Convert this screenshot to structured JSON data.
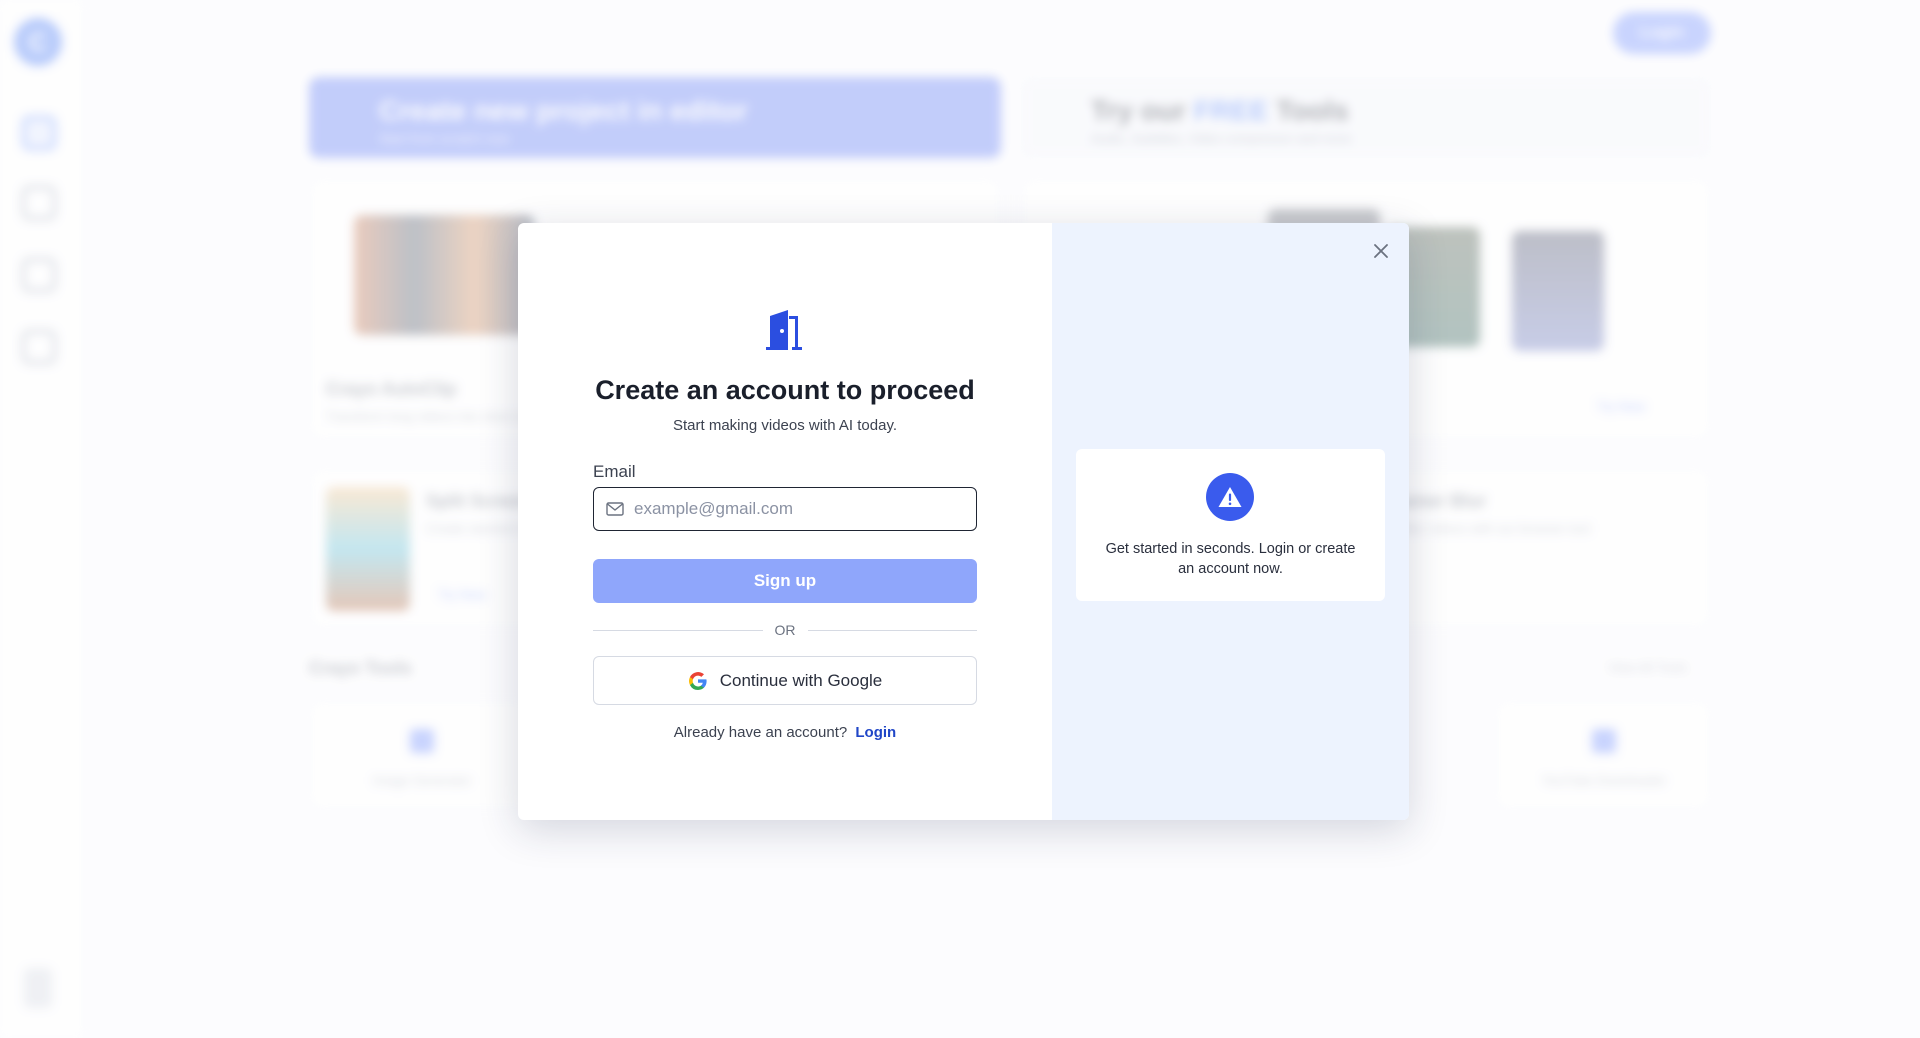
{
  "background": {
    "top_login_label": "Login",
    "banner_left": {
      "title": "Create new project in editor",
      "subtitle": "Start from scratch now"
    },
    "banner_right": {
      "title_pre": "Try our",
      "title_free": "FREE",
      "title_post": "Tools",
      "subtitle": "Audio, Subtitles, Video compressor and more"
    },
    "autoclip": {
      "title": "Crayo AutoClip",
      "subtitle": "Transform long videos into short clips"
    },
    "split_screen": {
      "title": "Split Screen",
      "subtitle": "Create stacked videos",
      "cta": "Try Now"
    },
    "blur": {
      "title": "amer Blur",
      "subtitle": "Blur videos with our browser tool"
    },
    "try_now": "Try Now",
    "tools_heading": "Crayo Tools",
    "view_all": "View All Tools",
    "tool_left": "Image Generator",
    "tool_right": "YouTube Downloader"
  },
  "modal": {
    "title": "Create an account to proceed",
    "subtitle": "Start making videos with AI today.",
    "email_label": "Email",
    "email_placeholder": "example@gmail.com",
    "email_value": "",
    "signup_label": "Sign up",
    "or_label": "OR",
    "google_label": "Continue with Google",
    "login_prompt": "Already have an account?",
    "login_link": "Login",
    "info_text": "Get started in seconds. Login or create an account now."
  },
  "icons": {
    "door": "door-icon",
    "mail": "mail-icon",
    "google": "google-icon",
    "close": "close-icon",
    "warning": "warning-icon"
  },
  "colors": {
    "accent": "#3a5bed",
    "signup_button": "#8fa6fb",
    "login_link": "#2046c7",
    "right_panel": "#edf3fe"
  }
}
